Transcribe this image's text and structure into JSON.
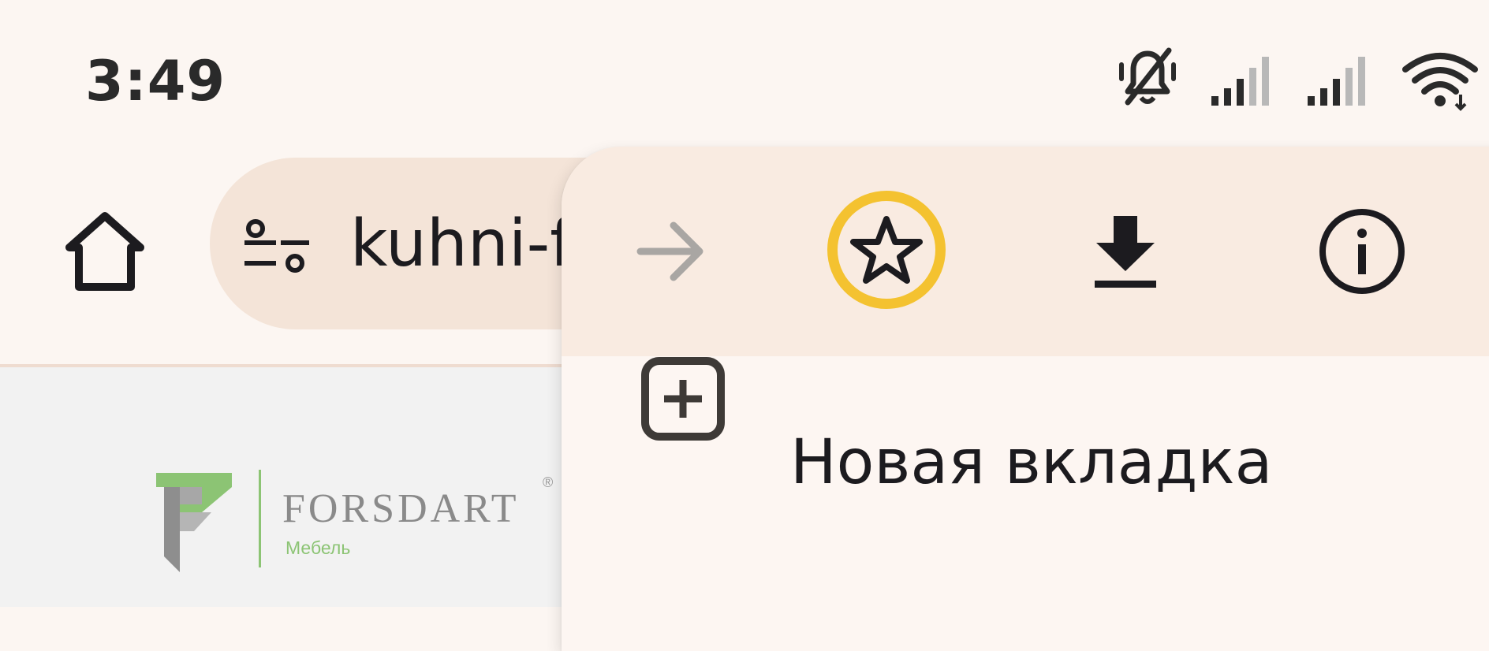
{
  "status_bar": {
    "time": "3:49",
    "icons": [
      "vibrate-silent-icon",
      "cell-signal-icon",
      "cell-signal-icon",
      "wifi-icon"
    ]
  },
  "toolbar": {
    "home_icon": "home-icon",
    "site_settings_icon": "tune-icon",
    "url": "kuhni-f"
  },
  "page": {
    "logo": {
      "name": "FORSDART",
      "registered": "®",
      "subtitle": "Мебель"
    }
  },
  "menu": {
    "actions": [
      {
        "icon": "forward-arrow-icon",
        "enabled": false
      },
      {
        "icon": "star-icon",
        "highlighted": true
      },
      {
        "icon": "download-icon"
      },
      {
        "icon": "info-icon"
      }
    ],
    "items": [
      {
        "icon": "new-tab-icon",
        "label": "Новая вкладка"
      }
    ]
  },
  "colors": {
    "background": "#fcf6f2",
    "omnibox": "#f4e4d8",
    "menu_top_row": "#f9ebe1",
    "highlight_ring": "#f4c230",
    "logo_green": "#8cc474",
    "logo_gray": "#8a8a8a"
  }
}
